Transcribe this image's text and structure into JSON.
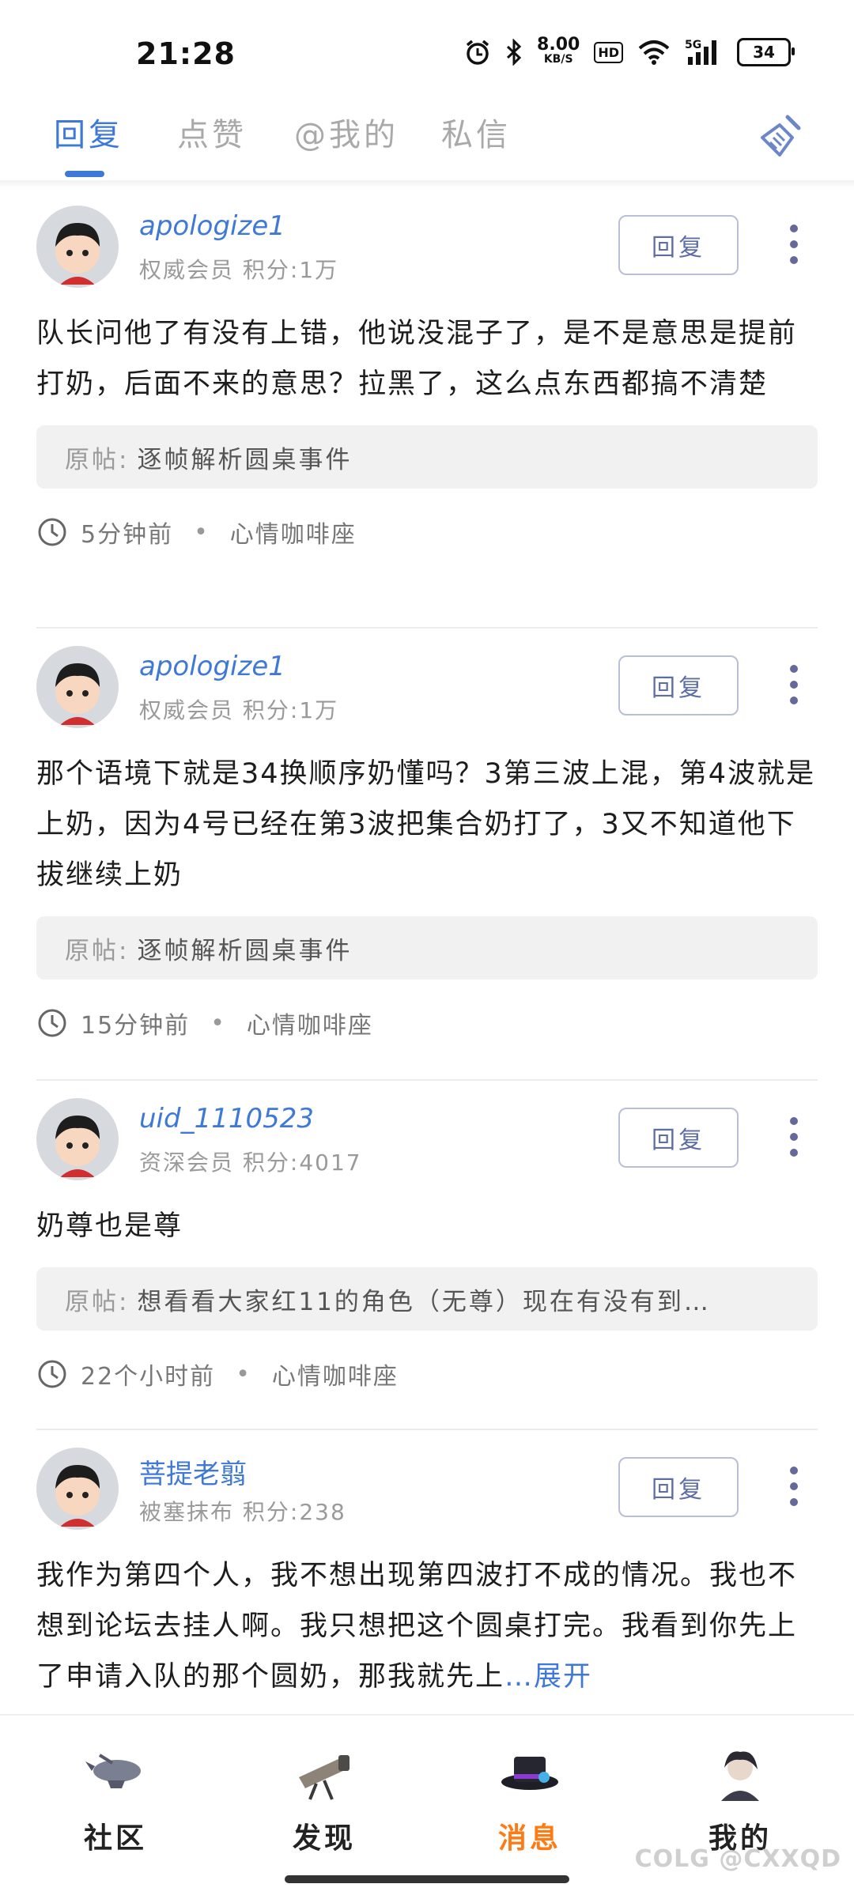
{
  "status_bar": {
    "time": "21:28",
    "net_speed_value": "8.00",
    "net_speed_unit": "KB/S",
    "hd": "HD",
    "network": "5G",
    "battery": "34",
    "icons": [
      "alarm-icon",
      "bluetooth-icon",
      "wifi-icon",
      "signal-icon",
      "battery-icon"
    ]
  },
  "tabs": [
    {
      "label": "回复",
      "active": true
    },
    {
      "label": "点赞",
      "active": false
    },
    {
      "label": "@我的",
      "active": false
    },
    {
      "label": "私信",
      "active": false
    }
  ],
  "clean_icon": "broom-icon",
  "items": [
    {
      "username": "apologize1",
      "rank": "权威会员",
      "score_label": "积分:",
      "score": "1万",
      "reply_label": "回复",
      "content": "队长问他了有没有上错，他说没混子了，是不是意思是提前打奶，后面不来的意思？拉黑了，这么点东西都搞不清楚",
      "origin_prefix": "原帖:",
      "origin_title": "逐帧解析圆桌事件",
      "time": "5分钟前",
      "board": "心情咖啡座"
    },
    {
      "username": "apologize1",
      "rank": "权威会员",
      "score_label": "积分:",
      "score": "1万",
      "reply_label": "回复",
      "content": "那个语境下就是34换顺序奶懂吗？3第三波上混，第4波就是上奶，因为4号已经在第3波把集合奶打了，3又不知道他下拔继续上奶",
      "origin_prefix": "原帖:",
      "origin_title": "逐帧解析圆桌事件",
      "time": "15分钟前",
      "board": "心情咖啡座"
    },
    {
      "username": "uid_1110523",
      "rank": "资深会员",
      "score_label": "积分:",
      "score": "4017",
      "reply_label": "回复",
      "content": "奶尊也是尊",
      "origin_prefix": "原帖:",
      "origin_title": "想看看大家红11的角色（无尊）现在有没有到…",
      "time": "22个小时前",
      "board": "心情咖啡座"
    },
    {
      "username": "菩提老翦",
      "rank": "被塞抹布",
      "score_label": "积分:",
      "score": "238",
      "reply_label": "回复",
      "content": "我作为第四个人，我不想出现第四波打不成的情况。我也不想到论坛去挂人啊。我只想把这个圆桌打完。我看到你先上了申请入队的那个圆奶，那我就先上",
      "expand_label": "…展开"
    }
  ],
  "bottom_nav": [
    {
      "label": "社区",
      "icon": "airship-icon",
      "active": false
    },
    {
      "label": "发现",
      "icon": "telescope-icon",
      "active": false
    },
    {
      "label": "消息",
      "icon": "hat-icon",
      "active": true
    },
    {
      "label": "我的",
      "icon": "character-avatar-icon",
      "active": false
    }
  ],
  "watermark": "COLG @CXXQD"
}
